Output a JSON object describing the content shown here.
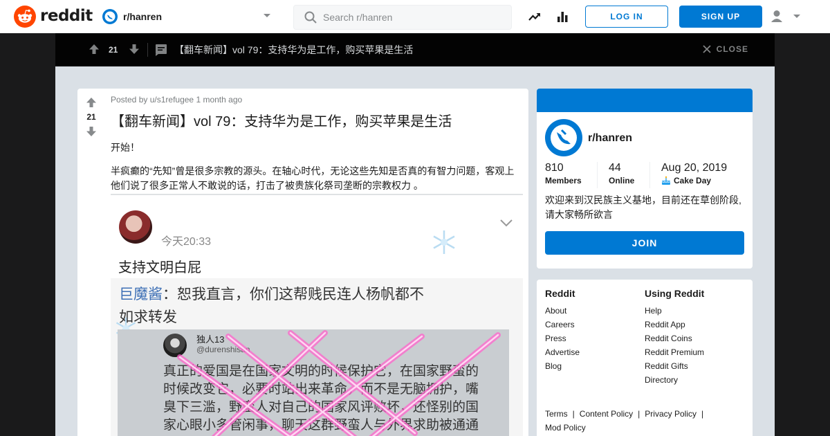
{
  "header": {
    "wordmark": "reddit",
    "subreddit": "r/hanren",
    "search_placeholder": "Search r/hanren",
    "login_label": "LOG IN",
    "signup_label": "SIGN UP",
    "icons": [
      "reddit-logo-icon",
      "subreddit-icon",
      "chevron-down-icon",
      "search-icon",
      "trending-icon",
      "stats-icon",
      "user-icon",
      "chevron-down-icon"
    ]
  },
  "post_bar": {
    "score": "21",
    "title": "【翻车新闻】vol 79：支持华为是工作，购买苹果是生活",
    "close_label": "CLOSE"
  },
  "post": {
    "score": "21",
    "posted_by_prefix": "Posted by",
    "author": "u/s1refugee",
    "age": "1 month ago",
    "title": "【翻车新闻】vol 79：支持华为是工作，购买苹果是生活",
    "paragraph1": "开始！",
    "paragraph2": "半疯癫的“先知”曾是很多宗教的源头。在轴心时代，无论这些先知是否真的有智力问题，客观上他们说了很多正常人不敢说的话，打击了被贵族化祭司垄断的宗教权力 。",
    "embed": {
      "time": "今天20:33",
      "title": "支持文明白屁",
      "quote_name": "巨魔酱",
      "quote_text": "：恕我直言，你们这帮贱民连人杨帆都不如求转发",
      "screenshot_name": "独人13",
      "screenshot_handle": "@durenshisan",
      "screenshot_text": "真正的爱国是在国家文明的时候保护它，在国家野蛮的时候改变它，必要时站出来革命，而不是无脑拥护，嘴臭下三滥，野蛮人对自己的国家风评败坏，还怪别的国家心眼小多管闲事，聊天这群野蛮人与外界求助被通通报告，我只会浪费金钱，还…"
    }
  },
  "sidebar": {
    "subreddit": "r/hanren",
    "members_value": "810",
    "members_label": "Members",
    "online_value": "44",
    "online_label": "Online",
    "cake_value": "Aug 20, 2019",
    "cake_label": "Cake Day",
    "description": "欢迎来到汉民族主义基地，目前还在草创阶段,请大家畅所欲言",
    "join_label": "JOIN"
  },
  "links": {
    "col1_title": "Reddit",
    "col1": [
      "About",
      "Careers",
      "Press",
      "Advertise",
      "Blog"
    ],
    "col2_title": "Using Reddit",
    "col2": [
      "Help",
      "Reddit App",
      "Reddit Coins",
      "Reddit Premium",
      "Reddit Gifts",
      "Directory"
    ],
    "legal": [
      "Terms",
      "Content Policy",
      "Privacy Policy",
      "Mod Policy"
    ]
  },
  "colors": {
    "brand_orange": "#ff4500",
    "accent_blue": "#0079d3",
    "overlay": "#1a1a1b",
    "page_bg": "#dae0e6"
  }
}
